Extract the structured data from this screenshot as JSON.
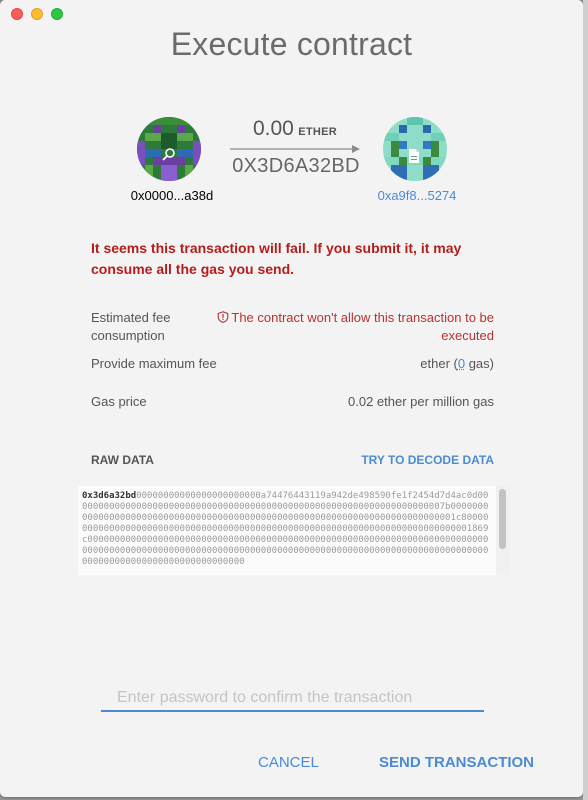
{
  "window": {
    "title": "Execute contract"
  },
  "transfer": {
    "from": {
      "address": "0x0000...a38d",
      "color": "#555555"
    },
    "to": {
      "address": "0xa9f8...5274",
      "color": "#4c8bd3"
    },
    "amount_value": "0.00",
    "amount_unit": "ETHER",
    "method": "0X3D6A32BD"
  },
  "warning": "It seems this transaction will fail. If you submit it, it may consume all the gas you send.",
  "fee": {
    "estimated_label": "Estimated fee consumption",
    "estimated_error": "The contract won't allow this transaction to be executed",
    "max_fee_label": "Provide maximum fee",
    "max_fee_prefix": "ether (",
    "max_fee_gas": "0",
    "max_fee_suffix": " gas)",
    "gas_price_label": "Gas price",
    "gas_price_value": "0.02 ether per million gas"
  },
  "raw": {
    "label": "RAW DATA",
    "decode_label": "TRY TO DECODE DATA",
    "selector": "0x3d6a32bd",
    "rest": "00000000000000000000000a74476443119a942de498590fe1f2454d7d4ac0d000000000000000000000000000000000000000000000000000000000000000000007b0000000000000000000000000000000000000000000000000000000000000000000000000001c80000000000000000000000000000000000000000000000000000000000000000000000000001869c00000000000000000000000000000000000000000000000000000000000000000000000000000000000000000000000000000000000000000000000000000000000000000000000000000000000000000000000000000000000"
  },
  "password": {
    "placeholder": "Enter password to confirm the transaction"
  },
  "buttons": {
    "cancel": "CANCEL",
    "send": "SEND TRANSACTION"
  },
  "colors": {
    "accent": "#4c8bd3",
    "error": "#b51d1d"
  }
}
